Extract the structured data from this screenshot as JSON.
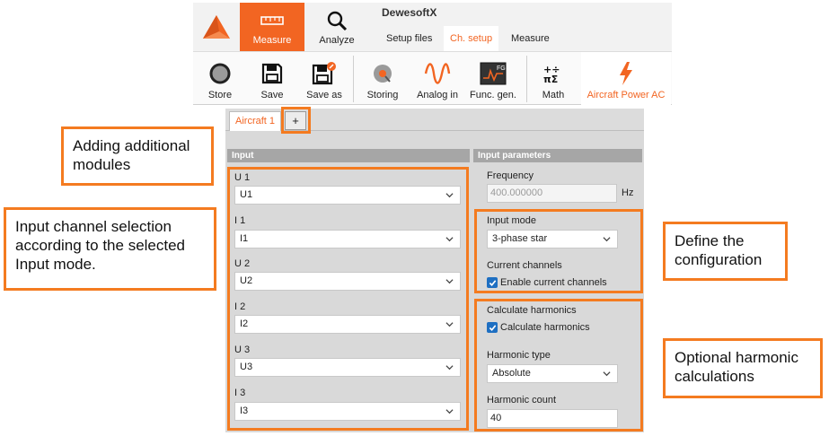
{
  "app": {
    "title": "DewesoftX"
  },
  "main_tabs": [
    {
      "label": "Measure",
      "icon": "ruler-icon",
      "active": true
    },
    {
      "label": "Analyze",
      "icon": "magnifier-icon",
      "active": false
    }
  ],
  "sub_tabs": [
    {
      "label": "Setup files",
      "active": false
    },
    {
      "label": "Ch. setup",
      "active": true
    },
    {
      "label": "Measure",
      "active": false
    }
  ],
  "toolbar": [
    {
      "label": "Store",
      "icon": "record-icon"
    },
    {
      "label": "Save",
      "icon": "floppy-icon"
    },
    {
      "label": "Save as",
      "icon": "floppy-edit-icon"
    },
    {
      "label": "Storing",
      "icon": "storing-icon"
    },
    {
      "label": "Analog in",
      "icon": "sine-wave-icon"
    },
    {
      "label": "Func. gen.",
      "icon": "function-generator-icon",
      "badge": "FG"
    },
    {
      "label": "Math",
      "icon": "math-icon"
    },
    {
      "label": "Aircraft Power AC",
      "icon": "lightning-icon",
      "active": true
    }
  ],
  "module_tabs": {
    "active": "Aircraft 1",
    "add_label": "+"
  },
  "input": {
    "header": "Input",
    "channels": [
      {
        "label": "U 1",
        "value": "U1"
      },
      {
        "label": "I 1",
        "value": "I1"
      },
      {
        "label": "U 2",
        "value": "U2"
      },
      {
        "label": "I 2",
        "value": "I2"
      },
      {
        "label": "U 3",
        "value": "U3"
      },
      {
        "label": "I 3",
        "value": "I3"
      }
    ]
  },
  "params": {
    "header": "Input parameters",
    "frequency_label": "Frequency",
    "frequency_value": "400.000000",
    "frequency_unit": "Hz",
    "input_mode_label": "Input mode",
    "input_mode_value": "3-phase star",
    "current_channels_label": "Current channels",
    "current_channels_checkbox": "Enable current channels",
    "calc_harmonics_label": "Calculate harmonics",
    "calc_harmonics_checkbox": "Calculate harmonics",
    "harmonic_type_label": "Harmonic type",
    "harmonic_type_value": "Absolute",
    "harmonic_count_label": "Harmonic count",
    "harmonic_count_value": "40"
  },
  "callouts": {
    "adding_modules": "Adding additional modules",
    "input_channel": "Input channel selection according to the selected Input mode.",
    "define_config": "Define the configuration",
    "harmonic_calcs": "Optional harmonic calculations"
  },
  "colors": {
    "accent": "#f26522",
    "highlight": "#f47b20",
    "checkbox": "#1e6fc2"
  }
}
